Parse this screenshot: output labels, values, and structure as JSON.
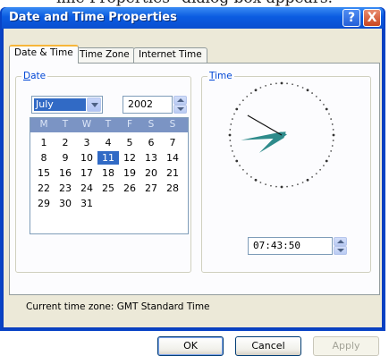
{
  "caption": "ime Properties\" dialog box appears.",
  "window": {
    "title": "Date and Time Properties",
    "help_glyph": "?",
    "close_glyph": "X"
  },
  "tabs": [
    {
      "label": "Date & Time",
      "active": true
    },
    {
      "label": "Time Zone",
      "active": false
    },
    {
      "label": "Internet Time",
      "active": false
    }
  ],
  "date_group": {
    "label_accel": "D",
    "label_rest": "ate",
    "month": "July",
    "year": "2002"
  },
  "calendar": {
    "weekday_headers": [
      "M",
      "T",
      "W",
      "T",
      "F",
      "S",
      "S"
    ],
    "weeks": [
      [
        "1",
        "2",
        "3",
        "4",
        "5",
        "6",
        "7"
      ],
      [
        "8",
        "9",
        "10",
        "11",
        "12",
        "13",
        "14"
      ],
      [
        "15",
        "16",
        "17",
        "18",
        "19",
        "20",
        "21"
      ],
      [
        "22",
        "23",
        "24",
        "25",
        "26",
        "27",
        "28"
      ],
      [
        "29",
        "30",
        "31",
        "",
        "",
        "",
        ""
      ]
    ],
    "selected_day": "11"
  },
  "time_group": {
    "label_accel": "T",
    "label_rest": "ime",
    "time_value": "07:43:50"
  },
  "timezone_text": "Current time zone:  GMT Standard Time",
  "buttons": {
    "ok": "OK",
    "cancel": "Cancel",
    "apply": "Apply"
  },
  "colors": {
    "titlebar": "#0b5ce1",
    "selection": "#316ac5",
    "group_label": "#0046d5",
    "clock_hand": "#2e8b8b"
  },
  "icons": {
    "help": "help-icon",
    "close": "close-icon",
    "dropdown": "chevron-down-icon",
    "spinner": "spinner-arrows-icon"
  }
}
